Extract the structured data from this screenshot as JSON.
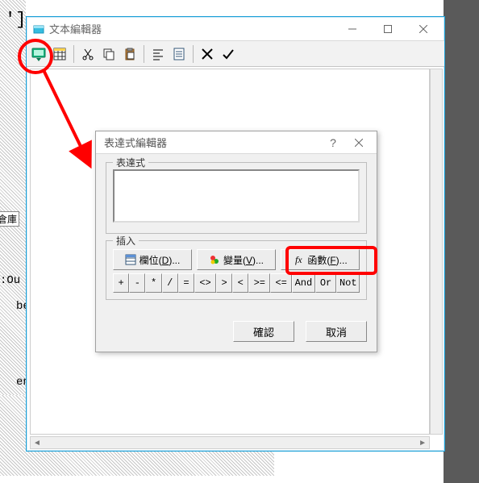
{
  "background": {
    "label": "倉庫",
    "code_cut": ":Ou",
    "code_line1": "begin",
    "code_line2": "end",
    "bracket": "']"
  },
  "window": {
    "title": "文本編輯器"
  },
  "dialog": {
    "title": "表達式編輯器",
    "group_expr": "表達式",
    "group_insert": "插入",
    "expr_value": "",
    "buttons": {
      "field": "欄位",
      "field_key": "D",
      "variable": "變量",
      "variable_key": "V",
      "function": "函數",
      "function_key": "F"
    },
    "ops": [
      "+",
      "-",
      "*",
      "/",
      "=",
      "<>",
      ">",
      "<",
      ">=",
      "<=",
      "And",
      "Or",
      "Not"
    ],
    "ok": "確認",
    "cancel": "取消"
  }
}
